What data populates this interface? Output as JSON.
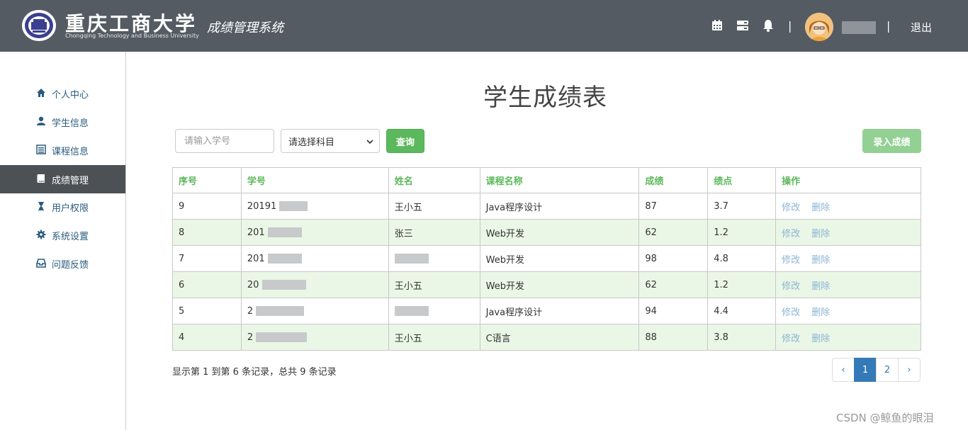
{
  "header": {
    "school_cn": "重庆工商大学",
    "school_en": "Chongqing Technology and Business University",
    "system_title": "成绩管理系统",
    "separator": "|",
    "logout": "退出"
  },
  "sidebar": {
    "items": [
      {
        "label": "个人中心",
        "icon": "home-icon"
      },
      {
        "label": "学生信息",
        "icon": "user-icon"
      },
      {
        "label": "课程信息",
        "icon": "list-icon"
      },
      {
        "label": "成绩管理",
        "icon": "book-icon",
        "active": true
      },
      {
        "label": "用户权限",
        "icon": "hourglass-icon"
      },
      {
        "label": "系统设置",
        "icon": "gear-icon"
      },
      {
        "label": "问题反馈",
        "icon": "inbox-icon"
      }
    ]
  },
  "main": {
    "title": "学生成绩表",
    "search_placeholder": "请输入学号",
    "subject_select": "请选择科目",
    "query_button": "查询",
    "add_button": "录入成绩"
  },
  "table": {
    "headers": [
      "序号",
      "学号",
      "姓名",
      "课程名称",
      "成绩",
      "绩点",
      "操作"
    ],
    "rows": [
      {
        "no": "9",
        "id": "20191",
        "name": "王小五",
        "course": "Java程序设计",
        "score": "87",
        "gpa": "3.7"
      },
      {
        "no": "8",
        "id": "201",
        "name": "张三",
        "course": "Web开发",
        "score": "62",
        "gpa": "1.2"
      },
      {
        "no": "7",
        "id": "201",
        "name": "",
        "course": "Web开发",
        "score": "98",
        "gpa": "4.8"
      },
      {
        "no": "6",
        "id": "20",
        "name": "王小五",
        "course": "Web开发",
        "score": "62",
        "gpa": "1.2"
      },
      {
        "no": "5",
        "id": "2",
        "name": "",
        "course": "Java程序设计",
        "score": "94",
        "gpa": "4.4"
      },
      {
        "no": "4",
        "id": "2",
        "name": "王小五",
        "course": "C语言",
        "score": "88",
        "gpa": "3.8"
      }
    ],
    "edit_label": "修改",
    "delete_label": "删除"
  },
  "footer": {
    "info": "显示第 1 到第 6 条记录，总共 9 条记录",
    "pager": {
      "prev": "‹",
      "pages": [
        "1",
        "2"
      ],
      "next": "›",
      "current": "1"
    }
  },
  "watermark": "CSDN @鲸鱼的眼泪",
  "colors": {
    "header_bg": "#545b62",
    "accent_green": "#5cb85c",
    "link_blue": "#337ab7",
    "row_stripe": "#eaf7e6"
  }
}
